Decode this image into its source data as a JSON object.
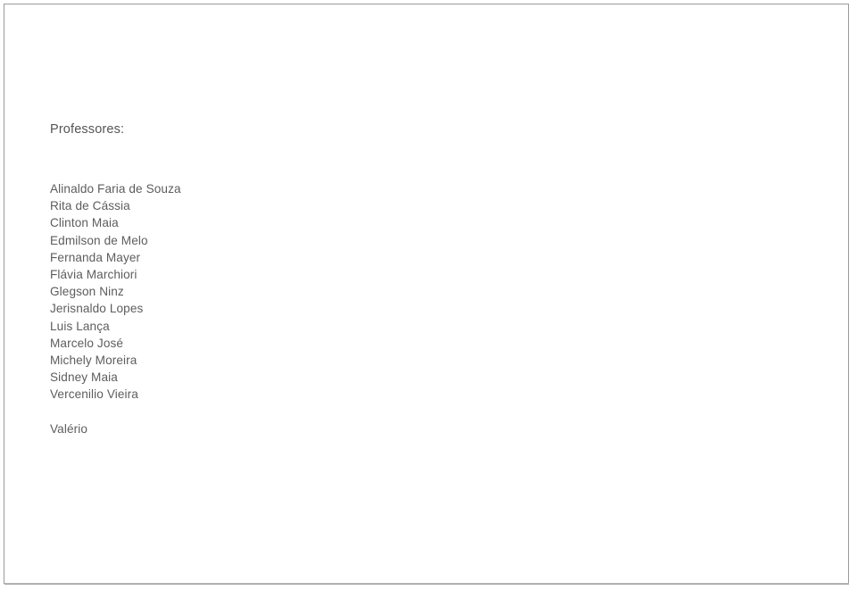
{
  "document": {
    "heading": "Professores:",
    "names": [
      "Alinaldo Faria de Souza",
      "Rita de Cássia",
      "Clinton Maia",
      "Edmilson de Melo",
      "Fernanda Mayer",
      "Flávia Marchiori",
      "Glegson Ninz",
      "Jerisnaldo Lopes",
      "Luis Lança",
      "Marcelo José",
      "Michely Moreira",
      "Sidney Maia",
      "Vercenilio Vieira"
    ],
    "trailing_name": "Valério",
    "colors": {
      "page_background": "#ffffff",
      "border": "#9a9a9a",
      "heading_text": "#555555",
      "body_text": "#5d5d5d"
    }
  }
}
